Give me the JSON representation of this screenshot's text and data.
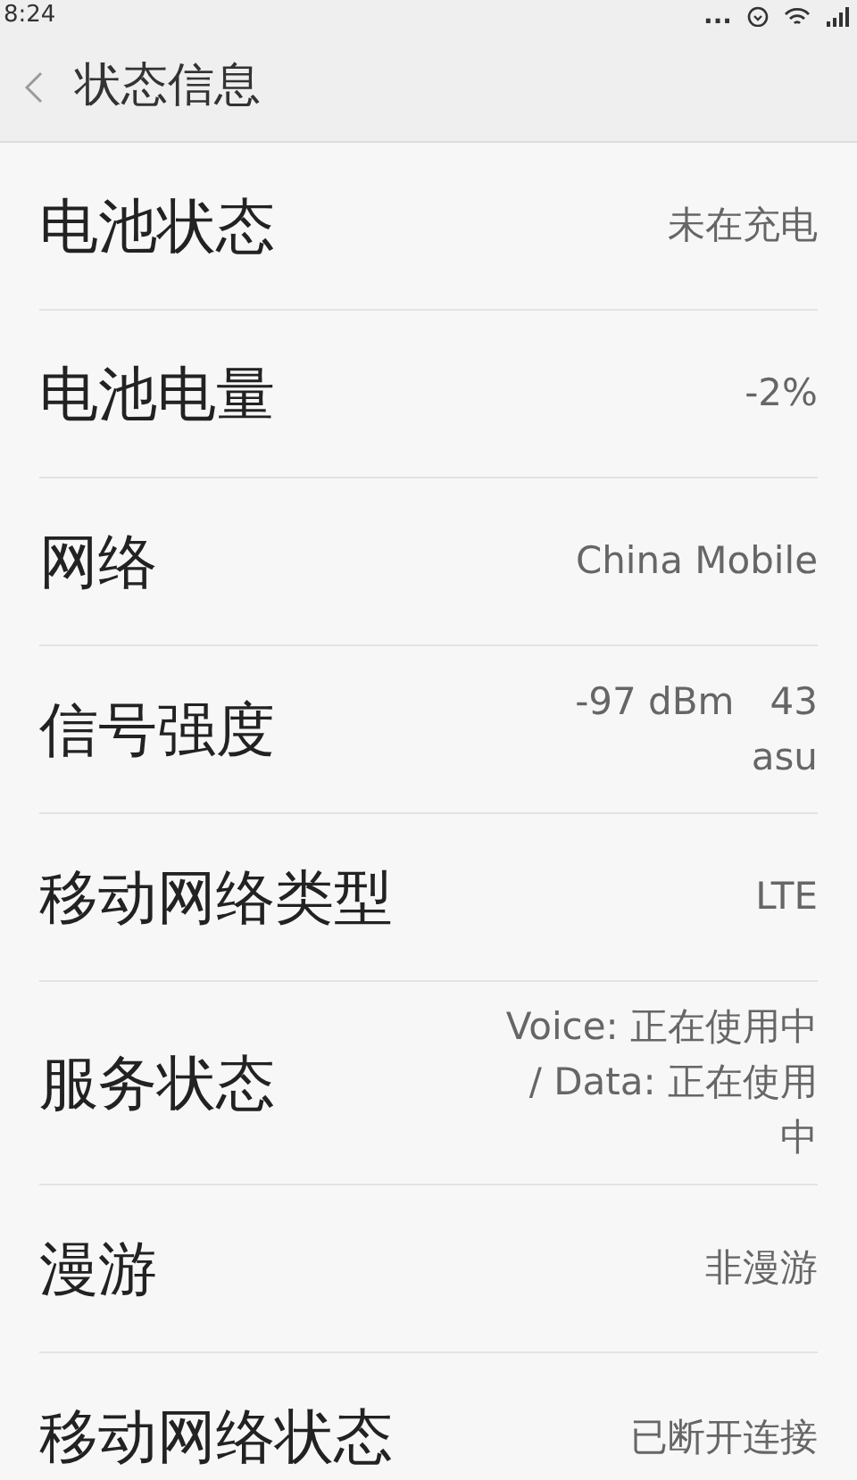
{
  "status_bar": {
    "time": "8:24",
    "notifications": "..."
  },
  "header": {
    "title": "状态信息"
  },
  "rows": [
    {
      "label": "电池状态",
      "value": "未在充电"
    },
    {
      "label": "电池电量",
      "value": "-2%"
    },
    {
      "label": "网络",
      "value": "China Mobile"
    },
    {
      "label": "信号强度",
      "value": "-97 dBm   43 asu"
    },
    {
      "label": "移动网络类型",
      "value": "LTE"
    },
    {
      "label": "服务状态",
      "value": "Voice: 正在使用中 / Data: 正在使用中"
    },
    {
      "label": "漫游",
      "value": "非漫游"
    },
    {
      "label": "移动网络状态",
      "value": "已断开连接"
    }
  ]
}
